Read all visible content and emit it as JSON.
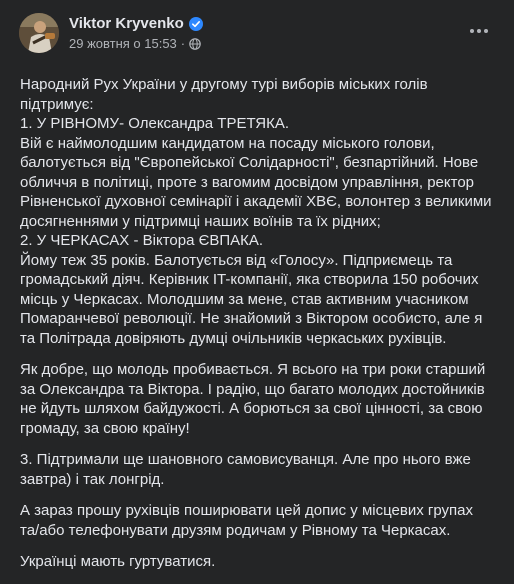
{
  "post": {
    "author": "Viktor Kryvenko",
    "timestamp": "29 жовтня о 15:53",
    "separator": "·",
    "icons": {
      "verified": "verified-badge-icon",
      "audience": "globe-icon",
      "menu": "more-options-icon"
    },
    "accent_color": "#2d88ff",
    "paragraphs": [
      [
        "Народний Рух України у другому турі виборів міських голів",
        "підтримує:",
        "1. У РІВНОМУ- Олександра ТРЕТЯКА.",
        "Вій є наймолодшим кандидатом на посаду міського голови,",
        "балотується від \"Європейської Солідарності\", безпартійний. Нове",
        "обличчя в політиці, проте з вагомим досвідом управління, ректор",
        "Рівненської духовної семінарії і академії ХВЄ, волонтер з великими",
        "досягненнями у підтримці наших воїнів та їх рідних;",
        "2. У ЧЕРКАСАХ - Віктора ЄВПАКА.",
        "Йому теж 35 років. Балотується від «Голосу». Підприємець та",
        "громадський діяч. Керівник IT-компанії, яка створила 150 робочих",
        "місць у Черкасах. Молодшим за мене, став активним учасником",
        "Помаранчевої революції. Не знайомий з Віктором особисто, але я",
        "та Політрада довіряють думці очільників черкаських рухівців."
      ],
      [
        "Як добре, що молодь пробивається. Я всього на три роки старший",
        "за Олександра та Віктора. І радію, що багато молодих достойників",
        "не йдуть шляхом байдужості. А борються за свої цінності, за свою",
        "громаду, за свою країну!"
      ],
      [
        "3. Підтримали ще шановного самовисуванця. Але про нього вже",
        "завтра) і так лонгрід."
      ],
      [
        "А зараз прошу рухівців поширювати  цей допис у місцевих групах",
        "та/або телефонувати друзям родичам у Рівному та Черкасах."
      ],
      [
        "Українці мають гуртуватися."
      ]
    ]
  }
}
